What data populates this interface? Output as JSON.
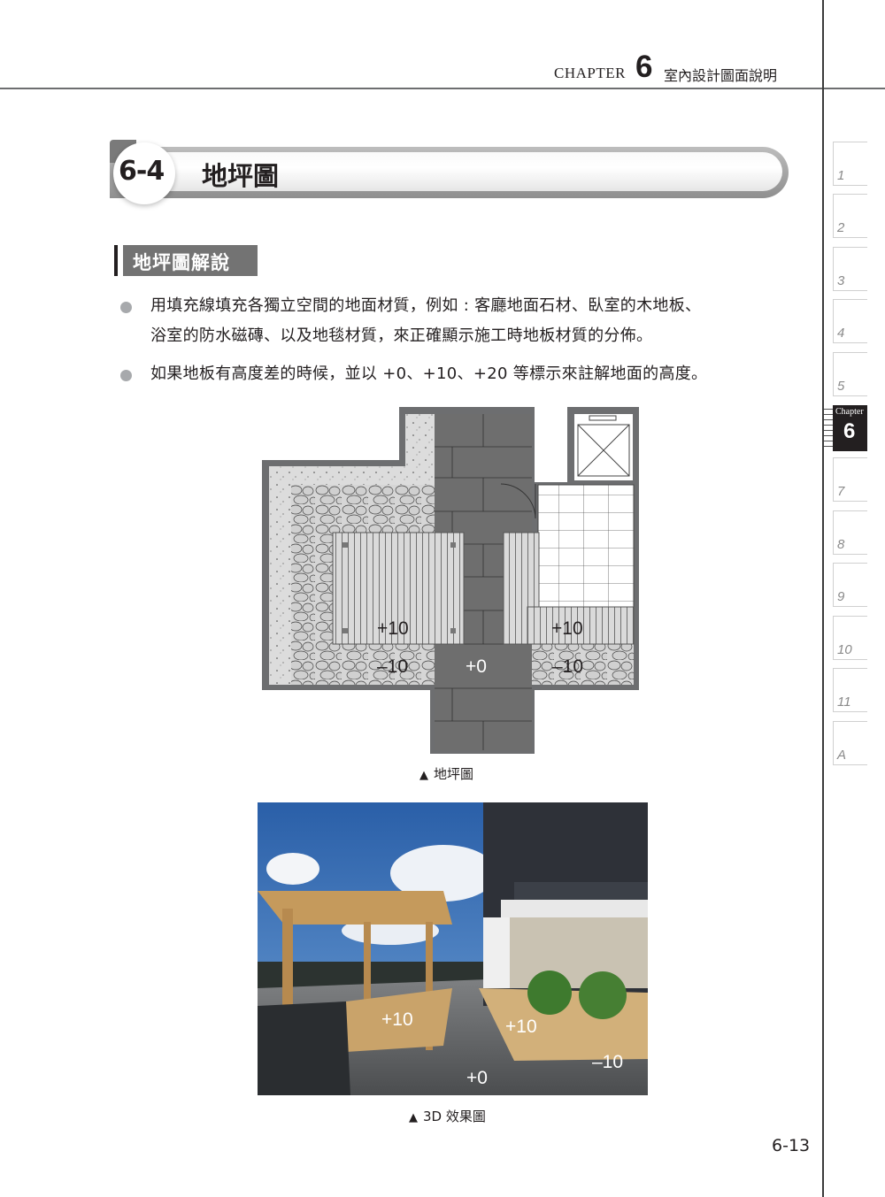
{
  "header": {
    "chapter_word": "CHAPTER",
    "chapter_number": "6",
    "chapter_title": "室內設計圖面說明"
  },
  "section": {
    "number": "6-4",
    "title": "地坪圖"
  },
  "subsection": {
    "title": "地坪圖解說"
  },
  "paragraphs": [
    {
      "lines": [
        "用填充線填充各獨立空間的地面材質，例如 : 客廳地面石材、臥室的木地板、",
        "浴室的防水磁磚、以及地毯材質，來正確顯示施工時地板材質的分佈。"
      ]
    },
    {
      "lines": [
        "如果地板有高度差的時候，並以 +0、+10、+20 等標示來註解地面的高度。"
      ]
    }
  ],
  "figure1": {
    "caption": "地坪圖",
    "caption_marker": "▲",
    "labels": {
      "deck_left": "+10",
      "deck_right": "+10",
      "pebble_left": "–10",
      "path_center": "+0",
      "pebble_right": "–10"
    }
  },
  "figure2": {
    "caption": "3D 效果圖",
    "caption_marker": "▲",
    "labels": {
      "deck_left": "+10",
      "deck_right": "+10",
      "path_center": "+0",
      "pebble_right": "–10"
    }
  },
  "page_number": "6-13",
  "chapter_tabs": [
    {
      "label": "1",
      "active": false
    },
    {
      "label": "2",
      "active": false
    },
    {
      "label": "3",
      "active": false
    },
    {
      "label": "4",
      "active": false
    },
    {
      "label": "5",
      "active": false
    },
    {
      "label": "6",
      "active": true,
      "prefix": "Chapter"
    },
    {
      "label": "7",
      "active": false
    },
    {
      "label": "8",
      "active": false
    },
    {
      "label": "9",
      "active": false
    },
    {
      "label": "10",
      "active": false
    },
    {
      "label": "11",
      "active": false
    },
    {
      "label": "A",
      "active": false
    }
  ],
  "colors": {
    "text": "#231f20",
    "subsection_bg": "#737373",
    "bullet": "#a7a9ac",
    "tab_active_bg": "#231f20",
    "tab_inactive_text": "#8a8a8a"
  }
}
